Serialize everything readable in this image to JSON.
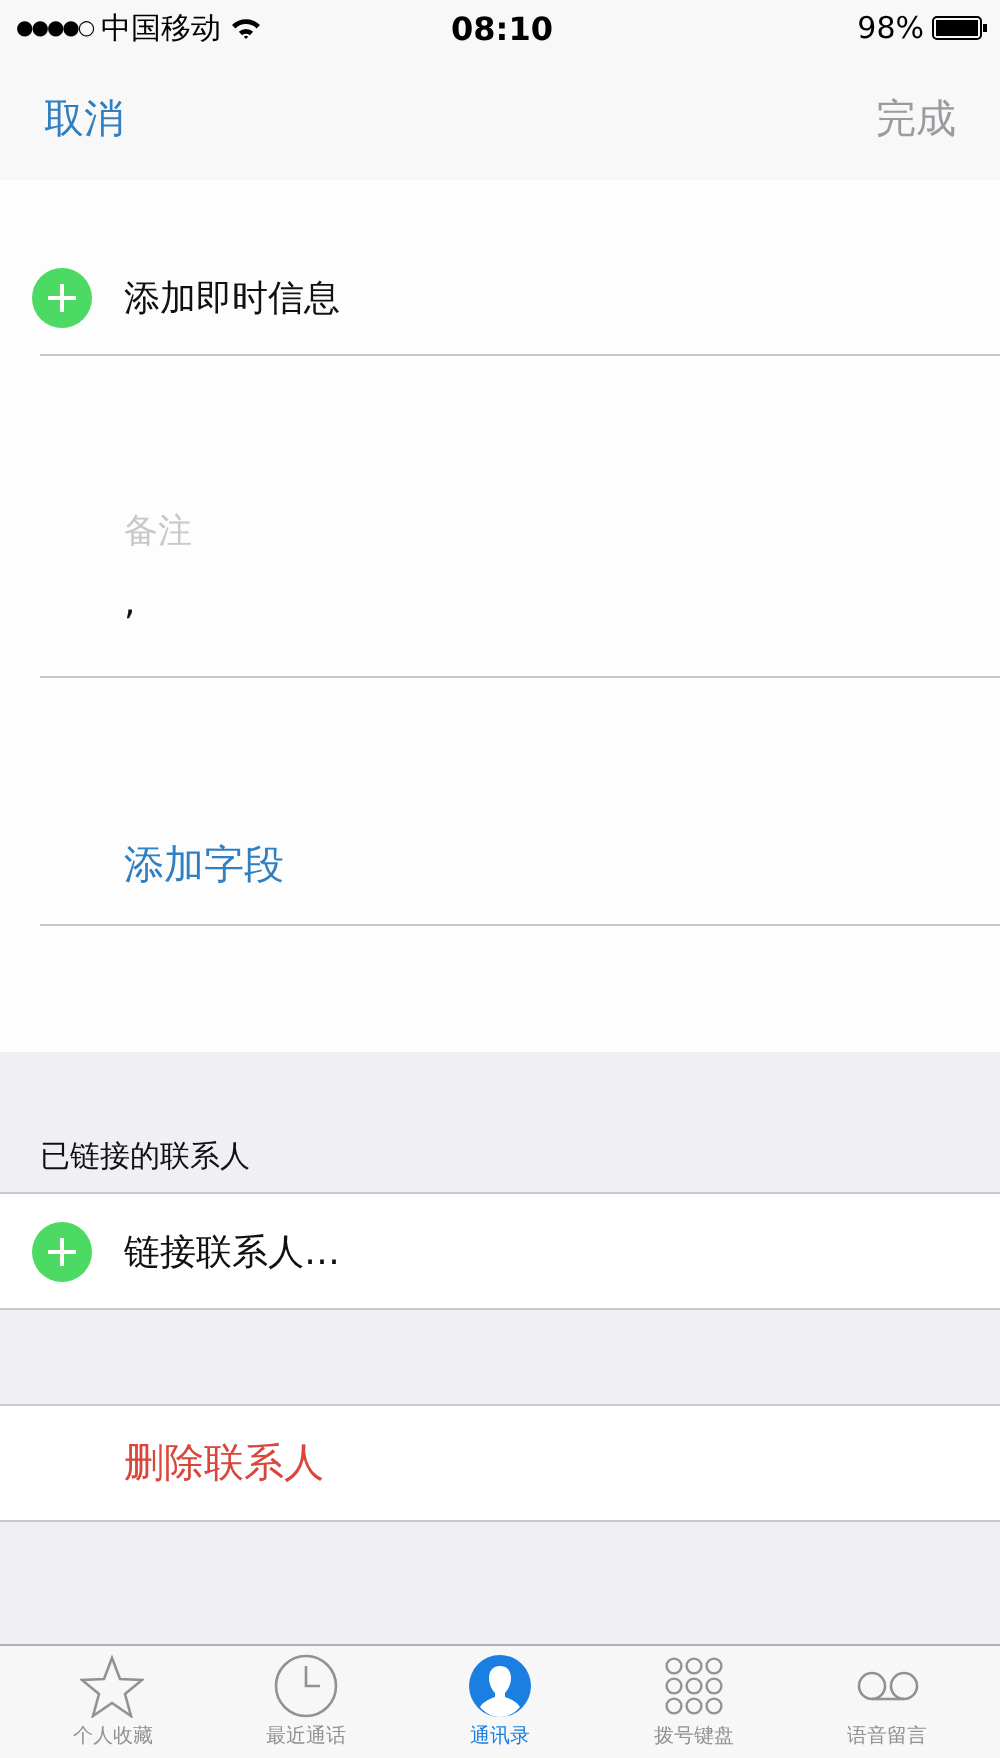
{
  "status_bar": {
    "signal": "●●●●○",
    "carrier": "中国移动",
    "time": "08:10",
    "battery": "98%"
  },
  "nav": {
    "cancel": "取消",
    "done": "完成",
    "done_disabled": true
  },
  "add_im": {
    "label": "添加即时信息"
  },
  "notes": {
    "label": "备注",
    "value": ","
  },
  "add_field": {
    "label": "添加字段"
  },
  "linked": {
    "header": "已链接的联系人",
    "link_label": "链接联系人…"
  },
  "delete": {
    "label": "删除联系人"
  },
  "tabs": [
    {
      "label": "个人收藏",
      "selected": false
    },
    {
      "label": "最近通话",
      "selected": false
    },
    {
      "label": "通讯录",
      "selected": true
    },
    {
      "label": "拨号键盘",
      "selected": false
    },
    {
      "label": "语音留言",
      "selected": false
    }
  ]
}
